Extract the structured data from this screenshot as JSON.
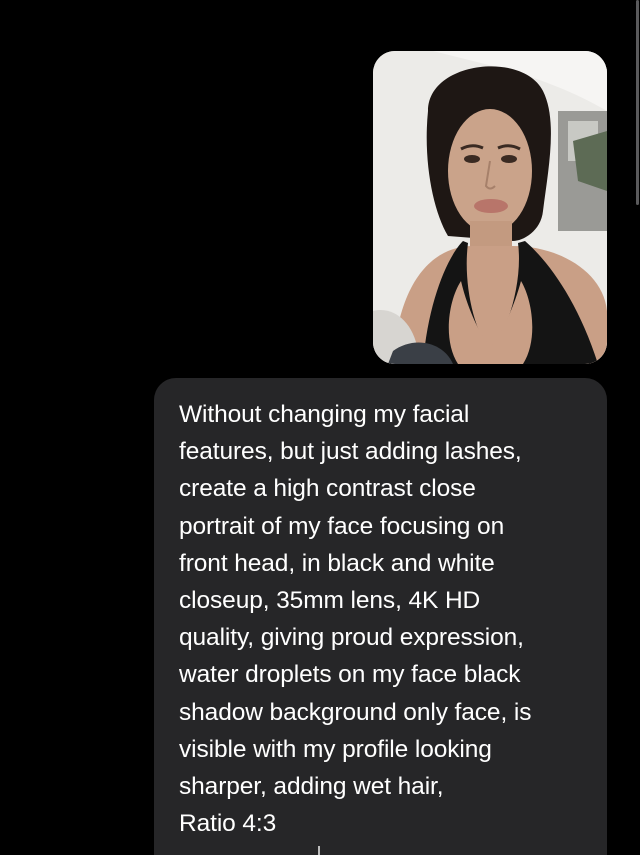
{
  "conversation": {
    "outgoing_photo": {
      "icon": "selfie-photo-icon",
      "description_visible": false
    },
    "outgoing_message": {
      "lines": [
        "Without changing my facial",
        "features, but just adding lashes,",
        "create a high contrast close",
        "portrait of my face focusing on",
        "front head, in black and white",
        "closeup, 35mm lens, 4K HD",
        "quality, giving proud expression,",
        "water droplets on my face black",
        "shadow background only face, is",
        "visible with my profile looking",
        "sharper, adding wet hair,",
        "Ratio 4:3"
      ]
    }
  },
  "colors": {
    "background": "#000000",
    "bubble": "#262628",
    "text": "#ffffff"
  }
}
